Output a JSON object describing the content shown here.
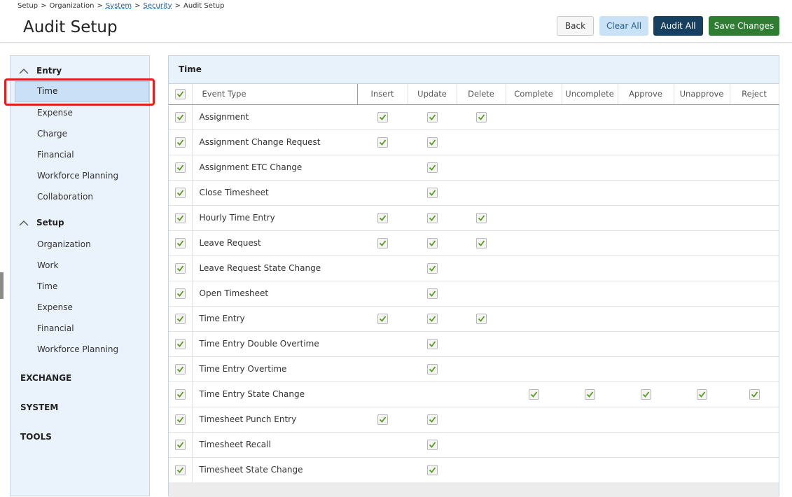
{
  "breadcrumb": [
    {
      "label": "Setup",
      "link": false
    },
    {
      "label": ">",
      "link": false
    },
    {
      "label": "Organization",
      "link": false
    },
    {
      "label": ">",
      "link": false
    },
    {
      "label": "System",
      "link": true
    },
    {
      "label": ">",
      "link": false
    },
    {
      "label": "Security",
      "link": true
    },
    {
      "label": ">",
      "link": false
    },
    {
      "label": "Audit Setup",
      "link": false
    }
  ],
  "page_title": "Audit Setup",
  "buttons": {
    "back": "Back",
    "clear_all": "Clear All",
    "audit_all": "Audit All",
    "save_changes": "Save Changes"
  },
  "sidebar": {
    "entry_group": "Entry",
    "entry_items": [
      "Time",
      "Expense",
      "Charge",
      "Financial",
      "Workforce Planning",
      "Collaboration"
    ],
    "setup_group": "Setup",
    "setup_items": [
      "Organization",
      "Work",
      "Time",
      "Expense",
      "Financial",
      "Workforce Planning"
    ],
    "sections": [
      "EXCHANGE",
      "SYSTEM",
      "TOOLS"
    ],
    "selected": "Time"
  },
  "panel": {
    "title": "Time",
    "columns": [
      "Event Type",
      "Insert",
      "Update",
      "Delete",
      "Complete",
      "Uncomplete",
      "Approve",
      "Unapprove",
      "Reject"
    ],
    "rows": [
      {
        "name": "Assignment",
        "checks": [
          true,
          true,
          true,
          false,
          false,
          false,
          false,
          false
        ]
      },
      {
        "name": "Assignment Change Request",
        "checks": [
          true,
          true,
          false,
          false,
          false,
          false,
          false,
          false
        ]
      },
      {
        "name": "Assignment ETC Change",
        "checks": [
          false,
          true,
          false,
          false,
          false,
          false,
          false,
          false
        ]
      },
      {
        "name": "Close Timesheet",
        "checks": [
          false,
          true,
          false,
          false,
          false,
          false,
          false,
          false
        ]
      },
      {
        "name": "Hourly Time Entry",
        "checks": [
          true,
          true,
          true,
          false,
          false,
          false,
          false,
          false
        ]
      },
      {
        "name": "Leave Request",
        "checks": [
          true,
          true,
          true,
          false,
          false,
          false,
          false,
          false
        ]
      },
      {
        "name": "Leave Request State Change",
        "checks": [
          false,
          true,
          false,
          false,
          false,
          false,
          false,
          false
        ]
      },
      {
        "name": "Open Timesheet",
        "checks": [
          false,
          true,
          false,
          false,
          false,
          false,
          false,
          false
        ]
      },
      {
        "name": "Time Entry",
        "checks": [
          true,
          true,
          true,
          false,
          false,
          false,
          false,
          false
        ]
      },
      {
        "name": "Time Entry Double Overtime",
        "checks": [
          false,
          true,
          false,
          false,
          false,
          false,
          false,
          false
        ]
      },
      {
        "name": "Time Entry Overtime",
        "checks": [
          false,
          true,
          false,
          false,
          false,
          false,
          false,
          false
        ]
      },
      {
        "name": "Time Entry State Change",
        "checks": [
          false,
          false,
          false,
          true,
          true,
          true,
          true,
          true
        ]
      },
      {
        "name": "Timesheet Punch Entry",
        "checks": [
          true,
          true,
          false,
          false,
          false,
          false,
          false,
          false
        ]
      },
      {
        "name": "Timesheet Recall",
        "checks": [
          false,
          true,
          false,
          false,
          false,
          false,
          false,
          false
        ]
      },
      {
        "name": "Timesheet State Change",
        "checks": [
          false,
          true,
          false,
          false,
          false,
          false,
          false,
          false
        ]
      }
    ]
  },
  "colors": {
    "check_green": "#5a9a1f",
    "save_green": "#2e7d32",
    "audit_navy": "#173f5f",
    "selection_outline": "#e0201f"
  },
  "icons": [
    "chevron-up-icon",
    "check-icon"
  ]
}
